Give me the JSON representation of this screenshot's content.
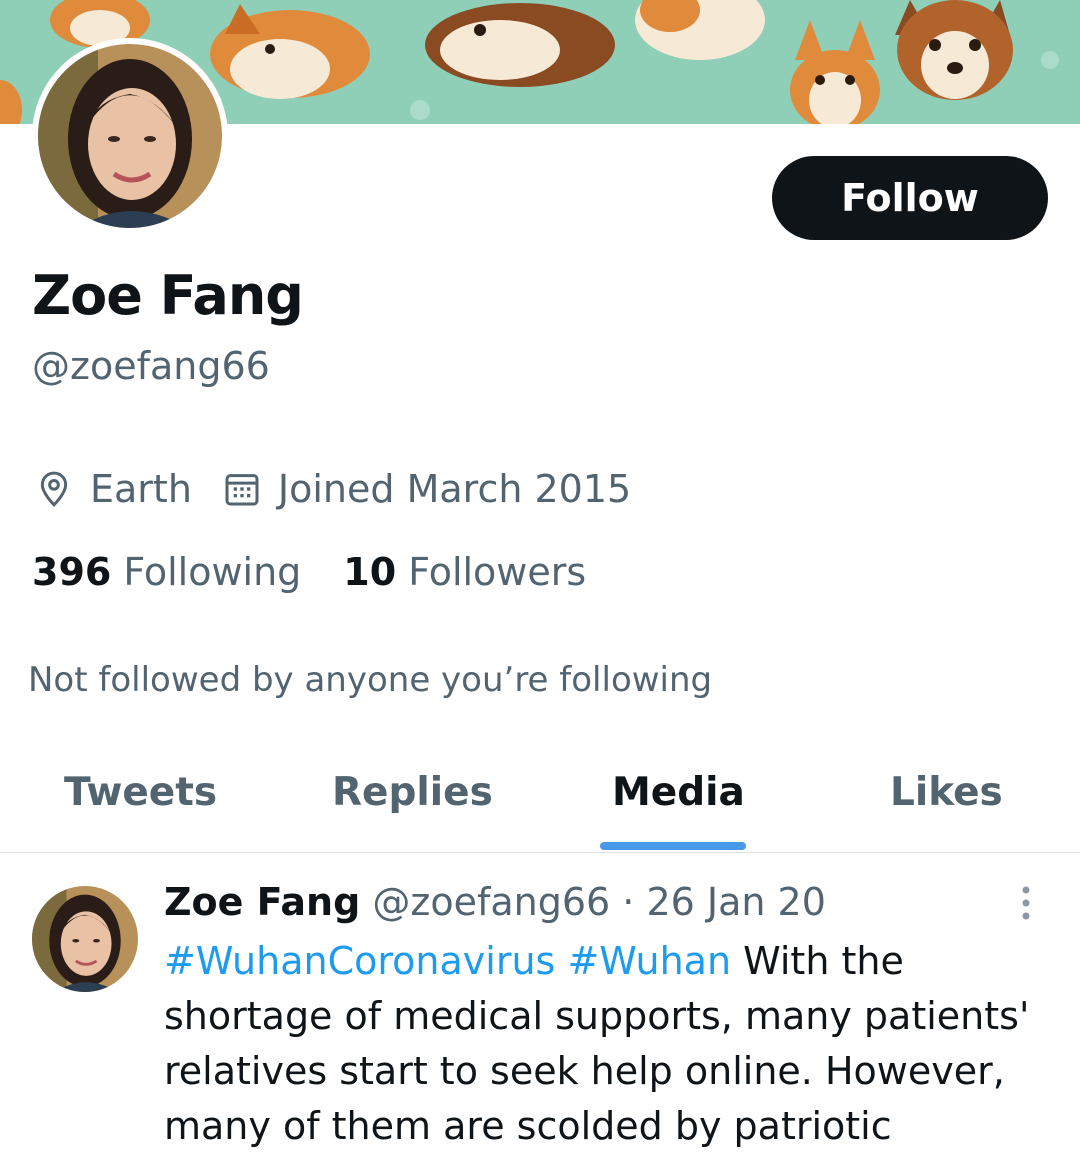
{
  "profile": {
    "name": "Zoe Fang",
    "handle": "@zoefang66",
    "location": "Earth",
    "joined": "Joined March 2015",
    "following_count": "396",
    "following_label": "Following",
    "followers_count": "10",
    "followers_label": "Followers",
    "not_followed_note": "Not followed by anyone you’re following",
    "follow_button": "Follow"
  },
  "icons": {
    "location": "location-pin-icon",
    "calendar": "calendar-icon",
    "more": "more-options-icon"
  },
  "tabs": [
    {
      "label": "Tweets",
      "active": false
    },
    {
      "label": "Replies",
      "active": false
    },
    {
      "label": "Media",
      "active": true
    },
    {
      "label": "Likes",
      "active": false
    }
  ],
  "tweet": {
    "author_name": "Zoe Fang",
    "author_handle": "@zoefang66",
    "separator": "·",
    "date": "26 Jan 20",
    "hashtag1": "#WuhanCoronavirus",
    "hashtag2": "#Wuhan",
    "text": "With the shortage of medical supports, many patients' relatives start to seek help online. However, many of them are scolded by patriotic"
  },
  "colors": {
    "banner": "#8fcfb8",
    "accent": "#1d9bf0",
    "tab_indicator": "#4a99e9",
    "secondary_text": "#536471",
    "primary_text": "#0f1419"
  }
}
